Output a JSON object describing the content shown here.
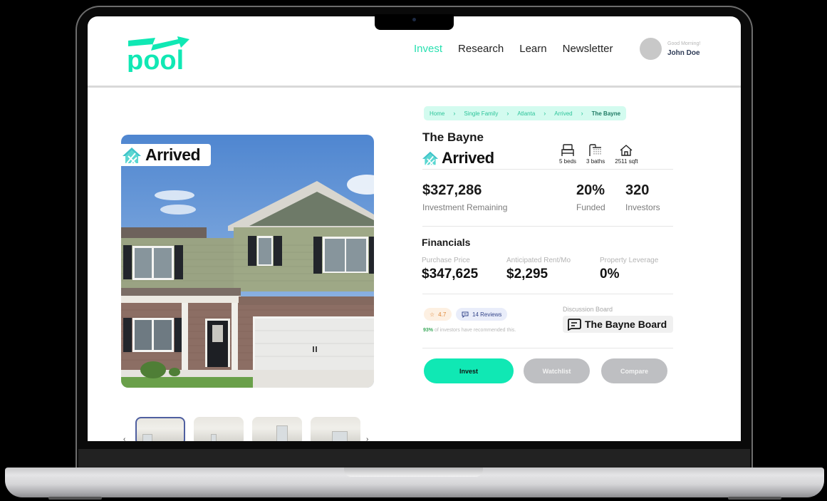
{
  "header": {
    "logo_text": "pool",
    "nav": [
      {
        "label": "Invest",
        "active": true
      },
      {
        "label": "Research",
        "active": false
      },
      {
        "label": "Learn",
        "active": false
      },
      {
        "label": "Newsletter",
        "active": false
      }
    ],
    "user": {
      "greeting": "Good Morning!",
      "name": "John Doe"
    }
  },
  "colors": {
    "brand": "#10e8b4",
    "accent_text": "#28e0b0",
    "breadcrumb_bg": "#d3fbef"
  },
  "breadcrumb": [
    "Home",
    "Single Family",
    "Atlanta",
    "Arrived",
    "The Bayne"
  ],
  "property": {
    "title": "The Bayne",
    "brand": "Arrived",
    "features": [
      {
        "icon": "bed-icon",
        "label": "5 beds"
      },
      {
        "icon": "shower-icon",
        "label": "3 baths"
      },
      {
        "icon": "house-icon",
        "label": "2511 sqft"
      }
    ]
  },
  "stats": {
    "remaining": {
      "value": "$327,286",
      "label": "Investment Remaining"
    },
    "funded": {
      "value": "20%",
      "label": "Funded"
    },
    "investors": {
      "value": "320",
      "label": "Investors"
    }
  },
  "financials": {
    "title": "Financials",
    "items": [
      {
        "label": "Purchase Price",
        "value": "$347,625"
      },
      {
        "label": "Anticipated Rent/Mo",
        "value": "$2,295"
      },
      {
        "label": "Property Leverage",
        "value": "0%"
      }
    ]
  },
  "community": {
    "rating": "4.7",
    "reviews": "14 Reviews",
    "recommend_pct": "93%",
    "recommend_text": " of investors have recommended this.",
    "discussion_label": "Discussion Board",
    "discussion_board": "The Bayne Board"
  },
  "actions": {
    "invest": "Invest",
    "watchlist": "Watchlist",
    "compare": "Compare"
  },
  "gallery": {
    "thumbnail_count": 4,
    "selected_index": 0
  }
}
